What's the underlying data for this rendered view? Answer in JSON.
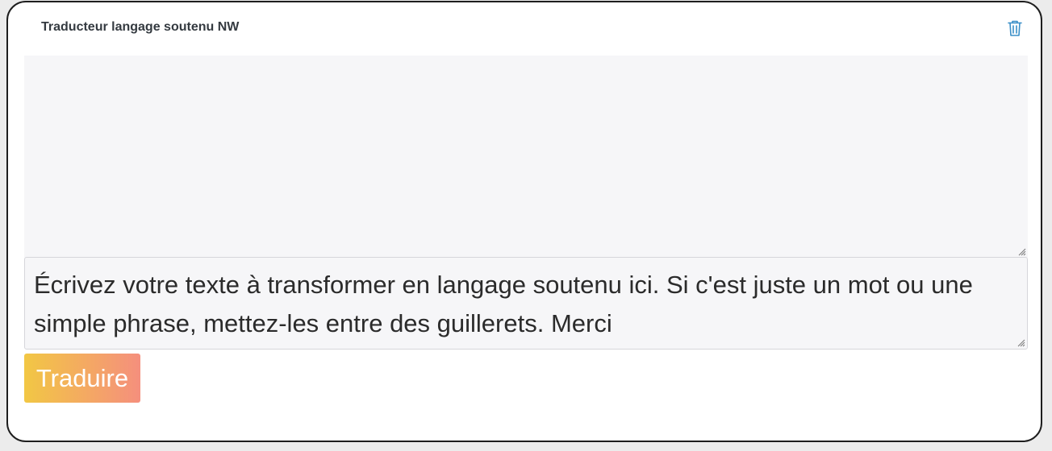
{
  "card": {
    "title": "Traducteur langage soutenu NW",
    "delete_icon": "trash-icon"
  },
  "output": {
    "value": ""
  },
  "input": {
    "value": "Écrivez votre texte à transformer en langage soutenu ici. Si c'est juste un mot ou une simple phrase, mettez-les entre des guillerets. Merci"
  },
  "translate_button": {
    "label": "Traduire"
  },
  "colors": {
    "accent_icon": "#3a8fc8",
    "button_gradient_start": "#f2c744",
    "button_gradient_end": "#f58f7d",
    "field_background": "#f6f6f8",
    "card_border": "#1e1e1e"
  }
}
